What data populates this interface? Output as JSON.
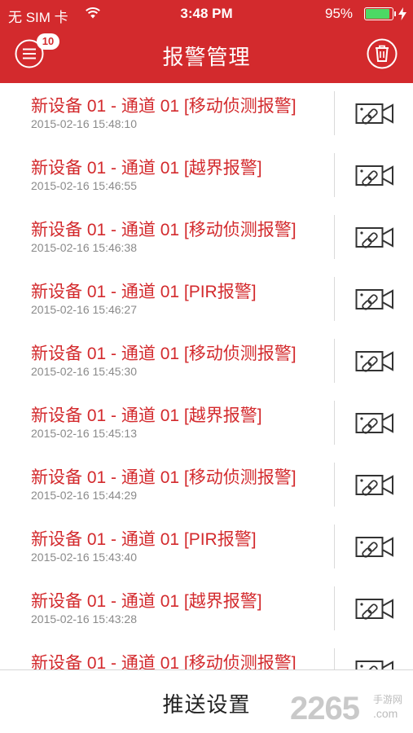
{
  "status_bar": {
    "carrier": "无 SIM 卡",
    "time": "3:48 PM",
    "battery_percent": "95%",
    "battery_level": 0.95,
    "wifi_icon": "wifi-icon",
    "charging_icon": "bolt-icon"
  },
  "header": {
    "title": "报警管理",
    "menu_badge": "10",
    "menu_icon": "menu-icon",
    "trash_icon": "trash-icon",
    "background_color": "#d32a2d"
  },
  "alarms": [
    {
      "title": "新设备 01 - 通道 01 [移动侦测报警]",
      "time": "2015-02-16 15:48:10"
    },
    {
      "title": "新设备 01 - 通道 01 [越界报警]",
      "time": "2015-02-16 15:46:55"
    },
    {
      "title": "新设备 01 - 通道 01 [移动侦测报警]",
      "time": "2015-02-16 15:46:38"
    },
    {
      "title": "新设备 01 - 通道 01 [PIR报警]",
      "time": "2015-02-16 15:46:27"
    },
    {
      "title": "新设备 01 - 通道 01 [移动侦测报警]",
      "time": "2015-02-16 15:45:30"
    },
    {
      "title": "新设备 01 - 通道 01 [越界报警]",
      "time": "2015-02-16 15:45:13"
    },
    {
      "title": "新设备 01 - 通道 01 [移动侦测报警]",
      "time": "2015-02-16 15:44:29"
    },
    {
      "title": "新设备 01 - 通道 01 [PIR报警]",
      "time": "2015-02-16 15:43:40"
    },
    {
      "title": "新设备 01 - 通道 01 [越界报警]",
      "time": "2015-02-16 15:43:28"
    },
    {
      "title": "新设备 01 - 通道 01 [移动侦测报警]",
      "time": ""
    }
  ],
  "alarm_icon": "linked-video-camera-icon",
  "footer": {
    "push_settings_label": "推送设置",
    "watermark": "2265",
    "watermark_sub": "手游网",
    "watermark_com": ".com"
  }
}
